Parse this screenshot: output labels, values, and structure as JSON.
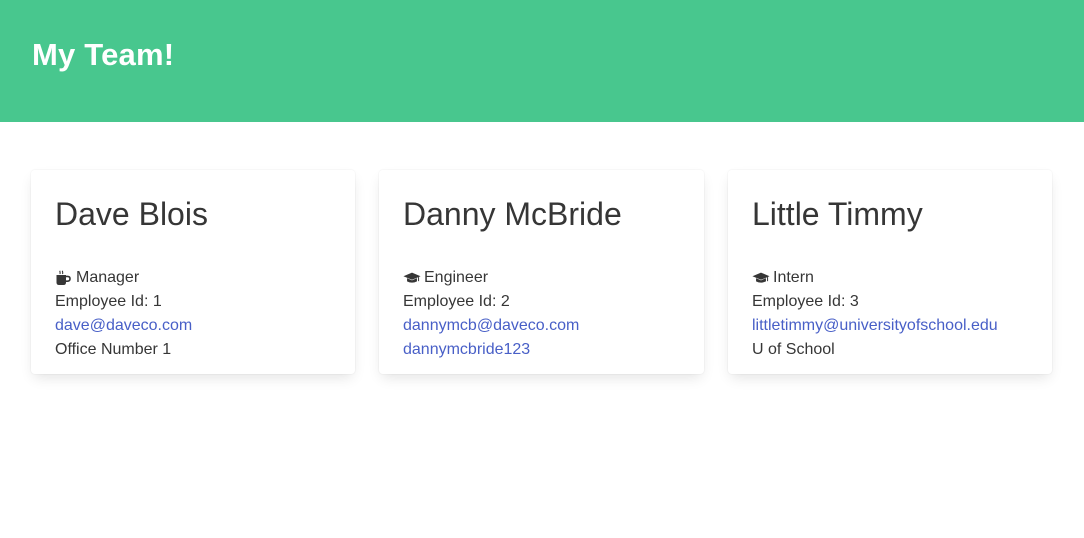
{
  "header": {
    "title": "My Team!"
  },
  "colors": {
    "header_bg": "#48c78e",
    "link": "#485fc7",
    "text": "#363636"
  },
  "employees": [
    {
      "name": "Dave Blois",
      "role": "Manager",
      "role_icon": "coffee-mug-icon",
      "employee_id": "Employee Id: 1",
      "email": "dave@daveco.com",
      "extra": "Office Number 1"
    },
    {
      "name": "Danny McBride",
      "role": "Engineer",
      "role_icon": "graduation-cap-icon",
      "employee_id": "Employee Id: 2",
      "email": "dannymcb@daveco.com",
      "extra": "dannymcbride123"
    },
    {
      "name": "Little Timmy",
      "role": "Intern",
      "role_icon": "graduation-cap-icon",
      "employee_id": "Employee Id: 3",
      "email": "littletimmy@universityofschool.edu",
      "extra": "U of School"
    }
  ]
}
